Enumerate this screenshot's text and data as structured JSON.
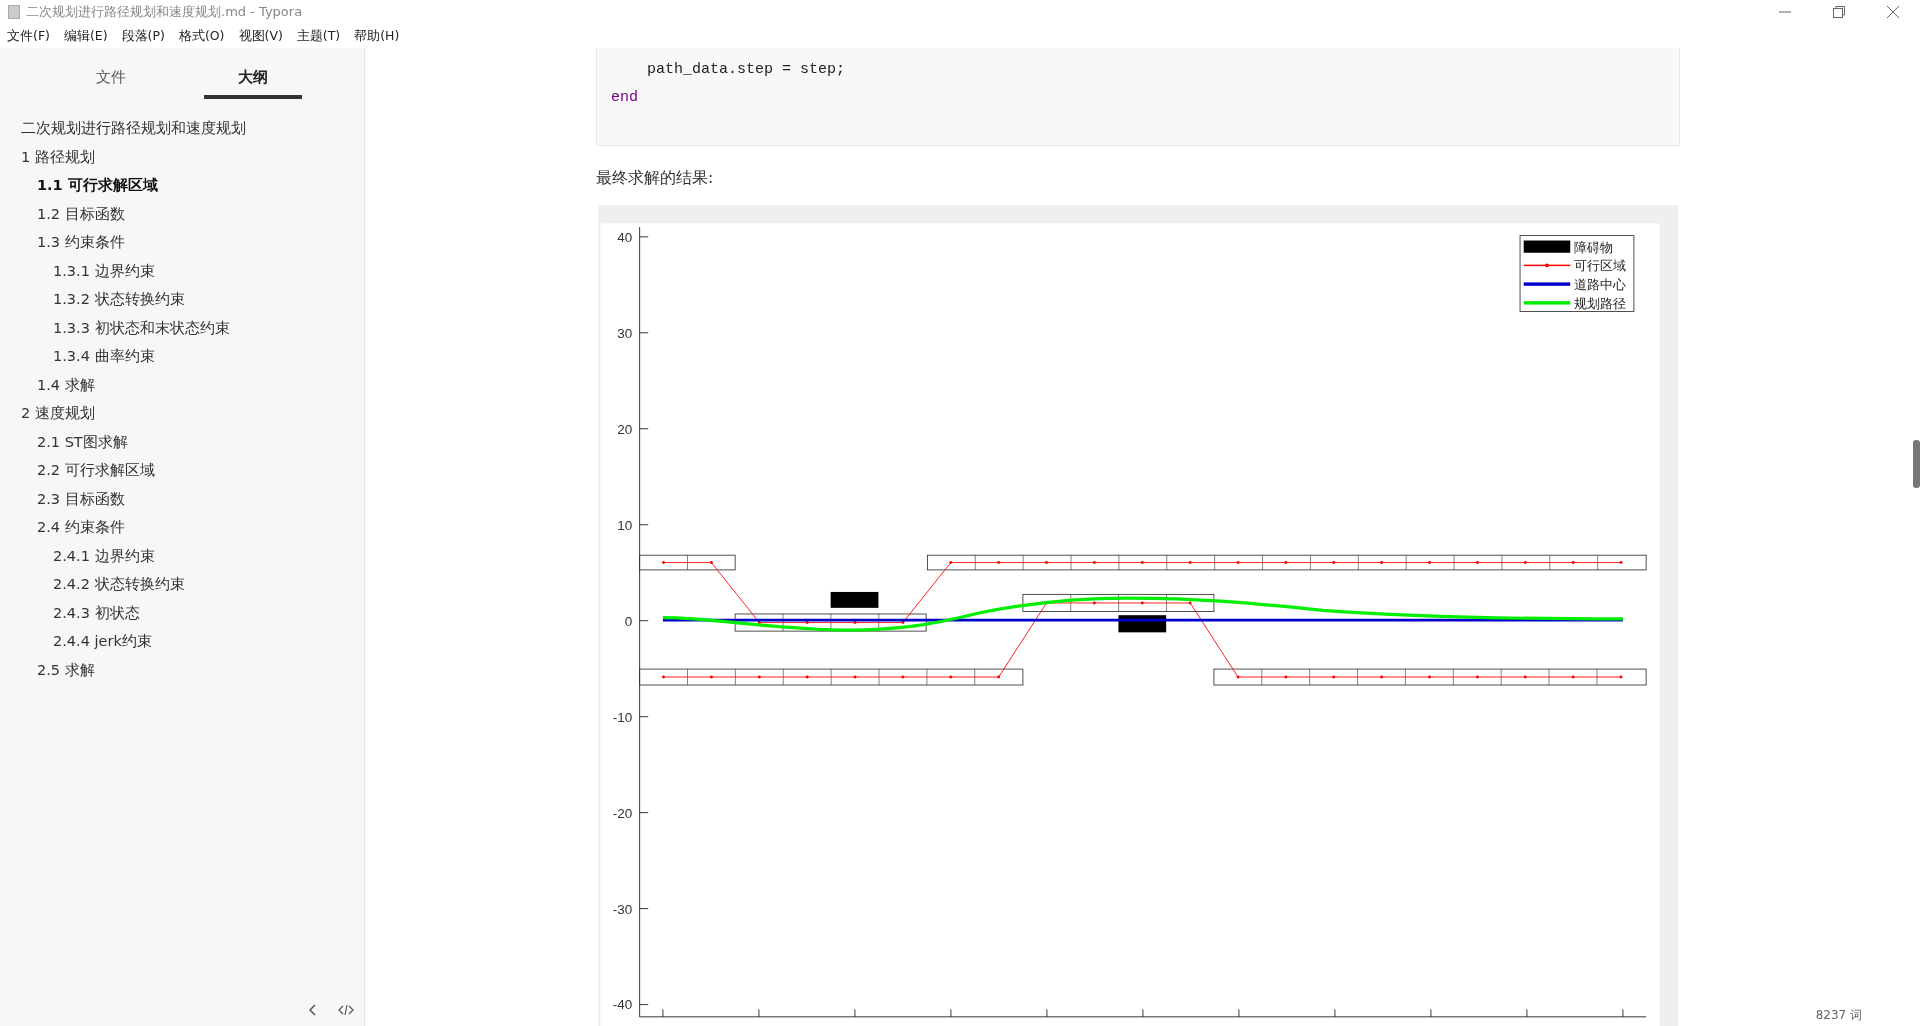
{
  "window": {
    "title": "二次规划进行路径规划和速度规划.md - Typora"
  },
  "menu": [
    "文件(F)",
    "编辑(E)",
    "段落(P)",
    "格式(O)",
    "视图(V)",
    "主题(T)",
    "帮助(H)"
  ],
  "sidebar": {
    "tabs": [
      {
        "label": "文件",
        "selected": false
      },
      {
        "label": "大纲",
        "selected": true
      }
    ],
    "outline": [
      {
        "label": "二次规划进行路径规划和速度规划",
        "selected": false
      },
      {
        "label": "1 路径规划",
        "selected": false,
        "children": [
          {
            "label": "1.1 可行求解区域",
            "selected": true
          },
          {
            "label": "1.2 目标函数",
            "selected": false
          },
          {
            "label": "1.3 约束条件",
            "selected": false,
            "children": [
              {
                "label": "1.3.1 边界约束",
                "selected": false
              },
              {
                "label": "1.3.2 状态转换约束",
                "selected": false
              },
              {
                "label": "1.3.3 初状态和末状态约束",
                "selected": false
              },
              {
                "label": "1.3.4 曲率约束",
                "selected": false
              }
            ]
          },
          {
            "label": "1.4 求解",
            "selected": false
          }
        ]
      },
      {
        "label": "2 速度规划",
        "selected": false,
        "children": [
          {
            "label": "2.1 ST图求解",
            "selected": false
          },
          {
            "label": "2.2 可行求解区域",
            "selected": false
          },
          {
            "label": "2.3 目标函数",
            "selected": false
          },
          {
            "label": "2.4 约束条件",
            "selected": false,
            "children": [
              {
                "label": "2.4.1 边界约束",
                "selected": false
              },
              {
                "label": "2.4.2 状态转换约束",
                "selected": false
              },
              {
                "label": "2.4.3 初状态",
                "selected": false
              },
              {
                "label": "2.4.4 jerk约束",
                "selected": false
              }
            ]
          },
          {
            "label": "2.5 求解",
            "selected": false
          }
        ]
      }
    ]
  },
  "code_block": [
    {
      "text": "    path_data.step = step;",
      "kind": "plain"
    },
    {
      "text": "end",
      "kind": "keyword"
    }
  ],
  "paragraph": "最终求解的结果:",
  "figure": {
    "yticks": [
      "40",
      "30",
      "20",
      "10",
      "0",
      "-10",
      "-20",
      "-30",
      "-40"
    ],
    "legend": [
      {
        "label": "障碍物",
        "kind": "patch",
        "color": "#000000"
      },
      {
        "label": "可行区域",
        "kind": "marker-line",
        "color": "#ff0000"
      },
      {
        "label": "道路中心",
        "kind": "line",
        "color": "#0000cc"
      },
      {
        "label": "规划路径",
        "kind": "line",
        "color": "#00ee00"
      }
    ]
  },
  "status_bar": {
    "word_count": "8237 词"
  }
}
